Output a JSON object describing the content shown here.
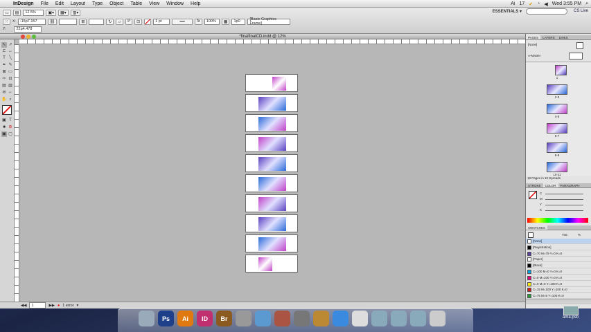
{
  "menubar": {
    "apple": "",
    "app": "InDesign",
    "items": [
      "File",
      "Edit",
      "Layout",
      "Type",
      "Object",
      "Table",
      "View",
      "Window",
      "Help"
    ],
    "status": {
      "ai": "17",
      "clock": "Wed 3:55 PM"
    }
  },
  "control": {
    "zoom_select": "12.5%",
    "x": "-15p7.157",
    "y": "22p4.478",
    "stroke_weight": "1 pt",
    "scale": "100%",
    "frame_style": "[Basic Graphics Frame]",
    "offset": "1p0",
    "essentials": "ESSENTIALS ▾",
    "cs_live": "CS Live"
  },
  "document": {
    "title": "*finalfinalCD.indd @ 12%"
  },
  "statusbar": {
    "page": "1",
    "errors": "1 error"
  },
  "pages_panel": {
    "tabs": [
      "PAGES",
      "LAYERS",
      "LINKS"
    ],
    "masters": [
      "[None]",
      "A-Master"
    ],
    "spreads": [
      "1",
      "2-3",
      "4-5",
      "6-7",
      "8-9",
      "10-11"
    ],
    "footer": "18 Pages in 10 Spreads"
  },
  "color_panel": {
    "tabs": [
      "STROKE",
      "COLOR",
      "PARAGRAPH"
    ],
    "channels": [
      "C",
      "M",
      "Y",
      "K"
    ]
  },
  "swatches": {
    "title": "SWATCHES",
    "tint_label": "Tint:",
    "tint_value": "%",
    "items": [
      {
        "name": "[None]",
        "color": "#ffffff"
      },
      {
        "name": "[Registration]",
        "color": "#000000"
      },
      {
        "name": "C=70 M=79 Y=0 K=0",
        "color": "#5a3f9a"
      },
      {
        "name": "[Paper]",
        "color": "#ffffff"
      },
      {
        "name": "[Black]",
        "color": "#000000"
      },
      {
        "name": "C=100 M=0 Y=0 K=0",
        "color": "#00a0e0"
      },
      {
        "name": "C=0 M=100 Y=0 K=0",
        "color": "#e0007a"
      },
      {
        "name": "C=0 M=0 Y=100 K=0",
        "color": "#ffee00"
      },
      {
        "name": "C=15 M=100 Y=100 K=0",
        "color": "#d01818"
      },
      {
        "name": "C=75 M=5 Y=100 K=0",
        "color": "#2a9a3a"
      }
    ]
  },
  "dock": {
    "items": [
      "Finder",
      "Ps",
      "Ai",
      "ID",
      "Br",
      "Preview",
      "iTunes",
      "Photos",
      "iMovie",
      "Garage",
      "Safari",
      "Calendar",
      "Folder",
      "Apps",
      "Downloads",
      "Trash"
    ]
  },
  "desktop_file": "ama.psb",
  "colors": {
    "page_art_1": "#c040c8",
    "page_art_2": "#5a3fc0",
    "page_art_3": "#2a6ad8"
  }
}
